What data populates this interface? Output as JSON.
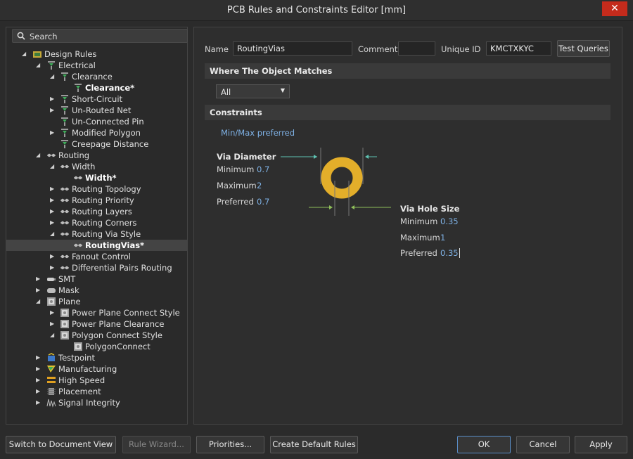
{
  "window": {
    "title": "PCB Rules and Constraints Editor [mm]",
    "close_glyph": "✕"
  },
  "search": {
    "placeholder": "Search"
  },
  "tree": [
    {
      "label": "Design Rules",
      "level": 0,
      "arrow": "down",
      "icon": "design-rules-icon",
      "bold": false
    },
    {
      "label": "Electrical",
      "level": 1,
      "arrow": "down",
      "icon": "electrical-icon",
      "bold": false
    },
    {
      "label": "Clearance",
      "level": 2,
      "arrow": "down",
      "icon": "electrical-icon",
      "bold": false
    },
    {
      "label": "Clearance*",
      "level": 3,
      "arrow": "",
      "icon": "electrical-icon",
      "bold": true
    },
    {
      "label": "Short-Circuit",
      "level": 2,
      "arrow": "right",
      "icon": "electrical-icon",
      "bold": false
    },
    {
      "label": "Un-Routed Net",
      "level": 2,
      "arrow": "right",
      "icon": "electrical-icon",
      "bold": false
    },
    {
      "label": "Un-Connected Pin",
      "level": 2,
      "arrow": "",
      "icon": "electrical-icon",
      "bold": false
    },
    {
      "label": "Modified Polygon",
      "level": 2,
      "arrow": "right",
      "icon": "electrical-icon",
      "bold": false
    },
    {
      "label": "Creepage Distance",
      "level": 2,
      "arrow": "",
      "icon": "electrical-icon",
      "bold": false
    },
    {
      "label": "Routing",
      "level": 1,
      "arrow": "down",
      "icon": "routing-icon",
      "bold": false
    },
    {
      "label": "Width",
      "level": 2,
      "arrow": "down",
      "icon": "routing-icon",
      "bold": false
    },
    {
      "label": "Width*",
      "level": 3,
      "arrow": "",
      "icon": "routing-icon",
      "bold": true
    },
    {
      "label": "Routing Topology",
      "level": 2,
      "arrow": "right",
      "icon": "routing-icon",
      "bold": false
    },
    {
      "label": "Routing Priority",
      "level": 2,
      "arrow": "right",
      "icon": "routing-icon",
      "bold": false
    },
    {
      "label": "Routing Layers",
      "level": 2,
      "arrow": "right",
      "icon": "routing-icon",
      "bold": false
    },
    {
      "label": "Routing Corners",
      "level": 2,
      "arrow": "right",
      "icon": "routing-icon",
      "bold": false
    },
    {
      "label": "Routing Via Style",
      "level": 2,
      "arrow": "down",
      "icon": "routing-icon",
      "bold": false
    },
    {
      "label": "RoutingVias*",
      "level": 3,
      "arrow": "",
      "icon": "routing-icon",
      "bold": true,
      "selected": true
    },
    {
      "label": "Fanout Control",
      "level": 2,
      "arrow": "right",
      "icon": "routing-icon",
      "bold": false
    },
    {
      "label": "Differential Pairs Routing",
      "level": 2,
      "arrow": "right",
      "icon": "routing-icon",
      "bold": false
    },
    {
      "label": "SMT",
      "level": 1,
      "arrow": "right",
      "icon": "smt-icon",
      "bold": false
    },
    {
      "label": "Mask",
      "level": 1,
      "arrow": "right",
      "icon": "mask-icon",
      "bold": false
    },
    {
      "label": "Plane",
      "level": 1,
      "arrow": "down",
      "icon": "plane-icon",
      "bold": false
    },
    {
      "label": "Power Plane Connect Style",
      "level": 2,
      "arrow": "right",
      "icon": "plane-icon",
      "bold": false
    },
    {
      "label": "Power Plane Clearance",
      "level": 2,
      "arrow": "right",
      "icon": "plane-icon",
      "bold": false
    },
    {
      "label": "Polygon Connect Style",
      "level": 2,
      "arrow": "down",
      "icon": "plane-icon",
      "bold": false
    },
    {
      "label": "PolygonConnect",
      "level": 3,
      "arrow": "",
      "icon": "plane-icon",
      "bold": false
    },
    {
      "label": "Testpoint",
      "level": 1,
      "arrow": "right",
      "icon": "testpoint-icon",
      "bold": false
    },
    {
      "label": "Manufacturing",
      "level": 1,
      "arrow": "right",
      "icon": "manufacturing-icon",
      "bold": false
    },
    {
      "label": "High Speed",
      "level": 1,
      "arrow": "right",
      "icon": "high-speed-icon",
      "bold": false
    },
    {
      "label": "Placement",
      "level": 1,
      "arrow": "right",
      "icon": "placement-icon",
      "bold": false
    },
    {
      "label": "Signal Integrity",
      "level": 1,
      "arrow": "right",
      "icon": "signal-integrity-icon",
      "bold": false
    }
  ],
  "rule": {
    "name_label": "Name",
    "name_value": "RoutingVias",
    "comment_label": "Comment",
    "comment_value": "",
    "unique_id_label": "Unique ID",
    "unique_id_value": "KMCTXKYC",
    "test_queries": "Test Queries"
  },
  "where": {
    "title": "Where The Object Matches",
    "selected": "All"
  },
  "constraints": {
    "title": "Constraints",
    "mode": "Min/Max preferred",
    "via_diameter": {
      "title": "Via Diameter",
      "minimum_label": "Minimum",
      "minimum": "0.7",
      "maximum_label": "Maximum",
      "maximum": "2",
      "preferred_label": "Preferred",
      "preferred": "0.7"
    },
    "via_hole": {
      "title": "Via Hole Size",
      "minimum_label": "Minimum",
      "minimum": "0.35",
      "maximum_label": "Maximum",
      "maximum": "1",
      "preferred_label": "Preferred",
      "preferred": "0.35"
    }
  },
  "buttons": {
    "switch_view": "Switch to Document View",
    "rule_wizard": "Rule Wizard...",
    "priorities": "Priorities...",
    "create_default": "Create Default Rules",
    "ok": "OK",
    "cancel": "Cancel",
    "apply": "Apply"
  },
  "colors": {
    "via_copper": "#e3ae2a",
    "accent_blue": "#7fb2e6",
    "close_red": "#c42b1c"
  }
}
